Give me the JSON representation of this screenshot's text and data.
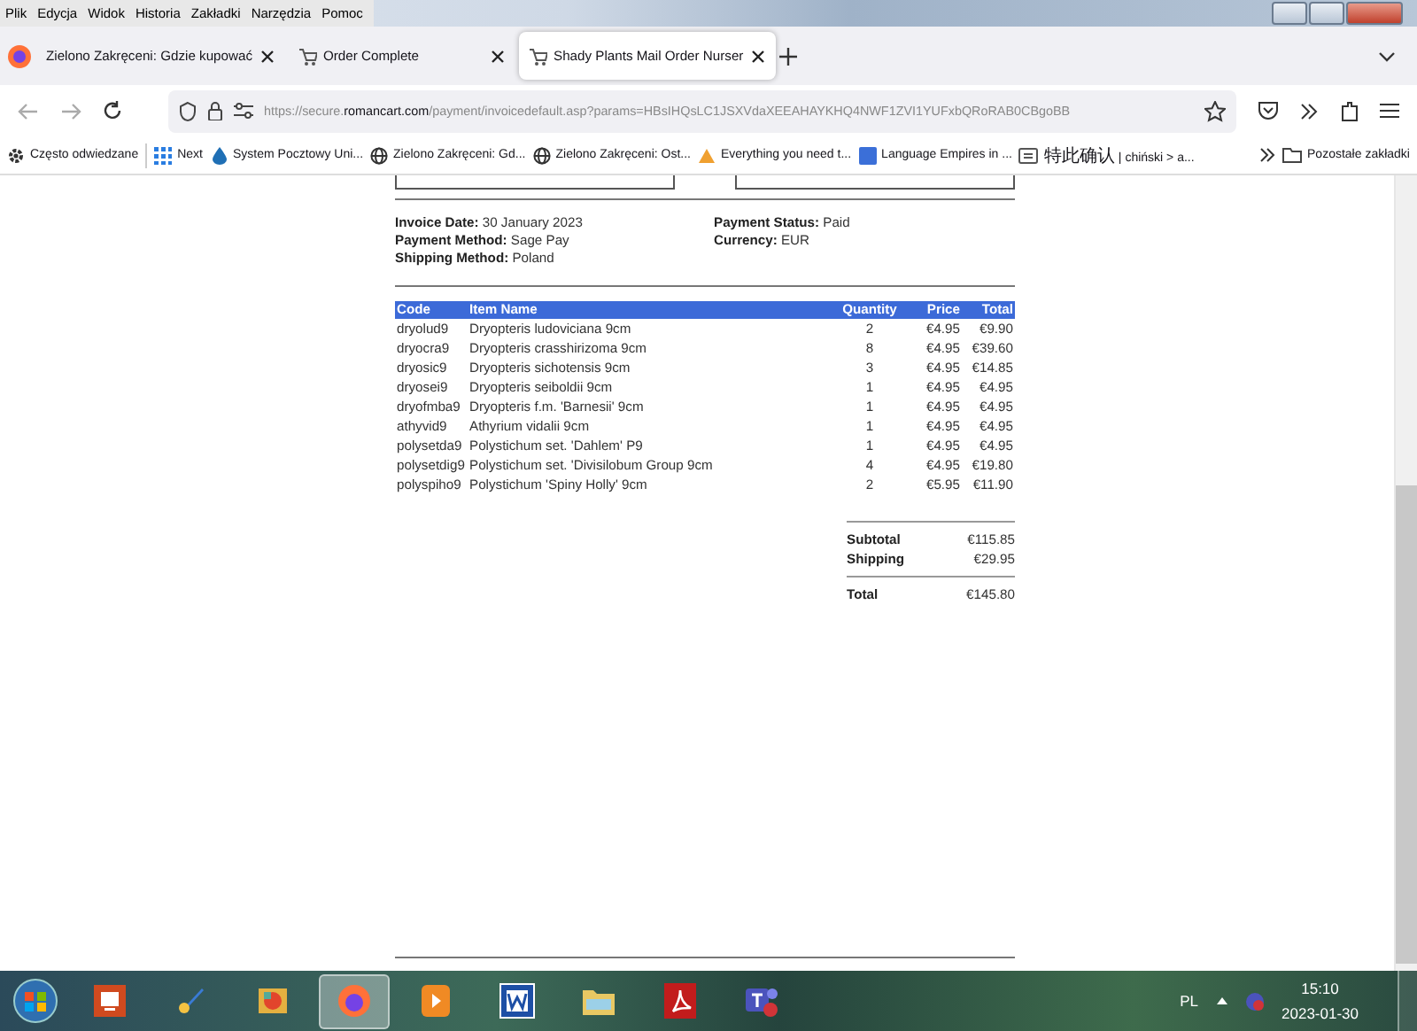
{
  "menu": [
    "Plik",
    "Edycja",
    "Widok",
    "Historia",
    "Zakładki",
    "Narzędzia",
    "Pomoc"
  ],
  "tabs": [
    {
      "label": "Zielono Zakręceni: Gdzie kupować",
      "selected": false
    },
    {
      "label": "Order Complete",
      "selected": false
    },
    {
      "label": "Shady Plants Mail Order Nurser",
      "selected": true
    }
  ],
  "address": {
    "url_prefix": "https://secure.",
    "url_domain": "romancart.com",
    "url_rest": "/payment/invoicedefault.asp?params=HBsIHQsLC1JSXVdaXEEAHAYKHQ4NWF1ZVI1YUFxbQRoRAB0CBgoBB"
  },
  "bookmarks": [
    {
      "label": "Często odwiedzane",
      "kind": "gear"
    },
    {
      "label": "Next",
      "kind": "apps"
    },
    {
      "label": "System Pocztowy Uni...",
      "kind": "mail"
    },
    {
      "label": "Zielono Zakręceni: Gd...",
      "kind": "globe"
    },
    {
      "label": "Zielono Zakręceni: Ost...",
      "kind": "globe"
    },
    {
      "label": "Everything you need t...",
      "kind": "warning"
    },
    {
      "label": "Language Empires in ...",
      "kind": "square"
    },
    {
      "label": "特此确认 | chiński > a...",
      "kind": "page"
    }
  ],
  "other_bookmarks": "Pozostałe zakładki",
  "invoice": {
    "info_left": [
      "**Invoice Date:** 30 January 2023",
      "**Payment Method:** Sage Pay",
      "**Shipping Method:** Poland"
    ],
    "info_right": [
      "**Payment Status:** Paid",
      "**Currency:** EUR"
    ],
    "columns": [
      "Code",
      "Item Name",
      "Quantity",
      "Price",
      "Total"
    ],
    "rows": [
      [
        "dryolud9",
        "Dryopteris ludoviciana 9cm",
        "2",
        "€4.95",
        "€9.90"
      ],
      [
        "dryocra9",
        "Dryopteris crasshirizoma 9cm",
        "8",
        "€4.95",
        "€39.60"
      ],
      [
        "dryosic9",
        "Dryopteris sichotensis 9cm",
        "3",
        "€4.95",
        "€14.85"
      ],
      [
        "dryosei9",
        "Dryopteris seiboldii 9cm",
        "1",
        "€4.95",
        "€4.95"
      ],
      [
        "dryofmba9",
        "Dryopteris f.m. 'Barnesii' 9cm",
        "1",
        "€4.95",
        "€4.95"
      ],
      [
        "athyvid9",
        "Athyrium vidalii 9cm",
        "1",
        "€4.95",
        "€4.95"
      ],
      [
        "polysetda9",
        "Polystichum set. 'Dahlem' P9",
        "1",
        "€4.95",
        "€4.95"
      ],
      [
        "polysetdig9",
        "Polystichum set. 'Divisilobum Group 9cm",
        "4",
        "€4.95",
        "€19.80"
      ],
      [
        "polyspiho9",
        "Polystichum 'Spiny Holly' 9cm",
        "2",
        "€5.95",
        "€11.90"
      ]
    ],
    "summary": [
      {
        "label": "Subtotal",
        "value": "€115.85"
      },
      {
        "label": "Shipping",
        "value": "€29.95"
      }
    ],
    "total": {
      "label": "Total",
      "value": "€145.80"
    }
  },
  "taskbar": {
    "apps": [
      {
        "kind": "start",
        "selected": false
      },
      {
        "kind": "slides",
        "selected": false
      },
      {
        "kind": "paint",
        "selected": false
      },
      {
        "kind": "gallery",
        "selected": false
      },
      {
        "kind": "browser",
        "selected": true
      },
      {
        "kind": "media",
        "selected": false
      },
      {
        "kind": "document",
        "selected": false
      },
      {
        "kind": "folder",
        "selected": false
      },
      {
        "kind": "pdf",
        "selected": false
      },
      {
        "kind": "chat",
        "selected": false
      }
    ],
    "language": "PL",
    "time": "15:10",
    "date": "2023-01-30"
  }
}
